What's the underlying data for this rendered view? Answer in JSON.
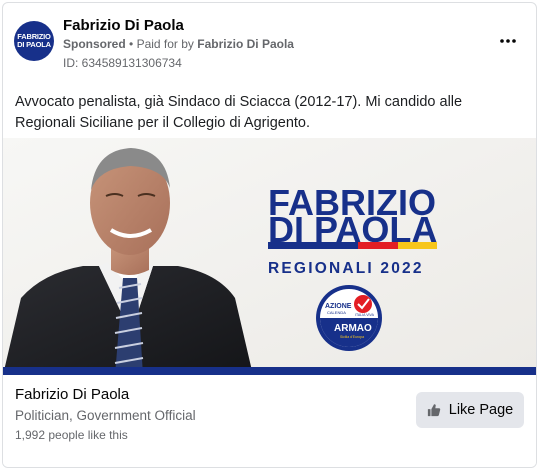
{
  "header": {
    "avatar_text": [
      "FABRIZIO",
      "DI PAOLA"
    ],
    "page_name": "Fabrizio Di Paola",
    "sponsored": "Sponsored",
    "separator": "•",
    "paid_for_by_prefix": "Paid for by",
    "paid_for_by_name": "Fabrizio Di Paola",
    "ad_id": "ID: 634589131306734"
  },
  "post": {
    "text": "Avvocato penalista, già Sindaco di Sciacca (2012-17). Mi candido alle Regionali Siciliane per il Collegio di Agrigento."
  },
  "hero": {
    "line1": "FABRIZIO",
    "line2": "DI PAOLA",
    "subtitle": "REGIONALI 2022",
    "badge_top": "AZIONE",
    "badge_top_sub": "CALENDA",
    "badge_right": "ITALIA VIVA",
    "badge_main": "ARMAO",
    "badge_bottom": "Sicilia d'Europa"
  },
  "footer": {
    "name": "Fabrizio Di Paola",
    "category": "Politician, Government Official",
    "likes": "1,992 people like this",
    "like_button_label": "Like Page"
  },
  "colors": {
    "brand_blue": "#17308a",
    "stripe_red": "#e31e24",
    "stripe_yellow": "#f7c61b",
    "text_secondary": "#65676b",
    "button_bg": "#e4e6eb"
  },
  "icons": [
    "more-options-icon",
    "thumbs-up-icon"
  ]
}
